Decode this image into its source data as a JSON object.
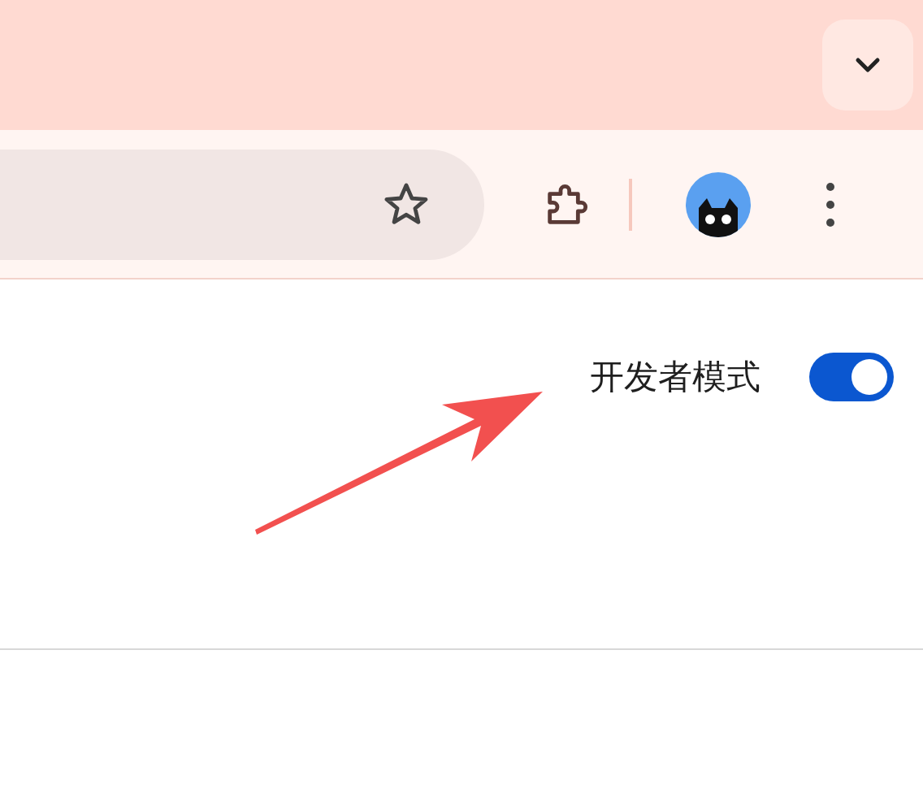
{
  "developer_mode": {
    "label": "开发者模式",
    "on": true
  }
}
